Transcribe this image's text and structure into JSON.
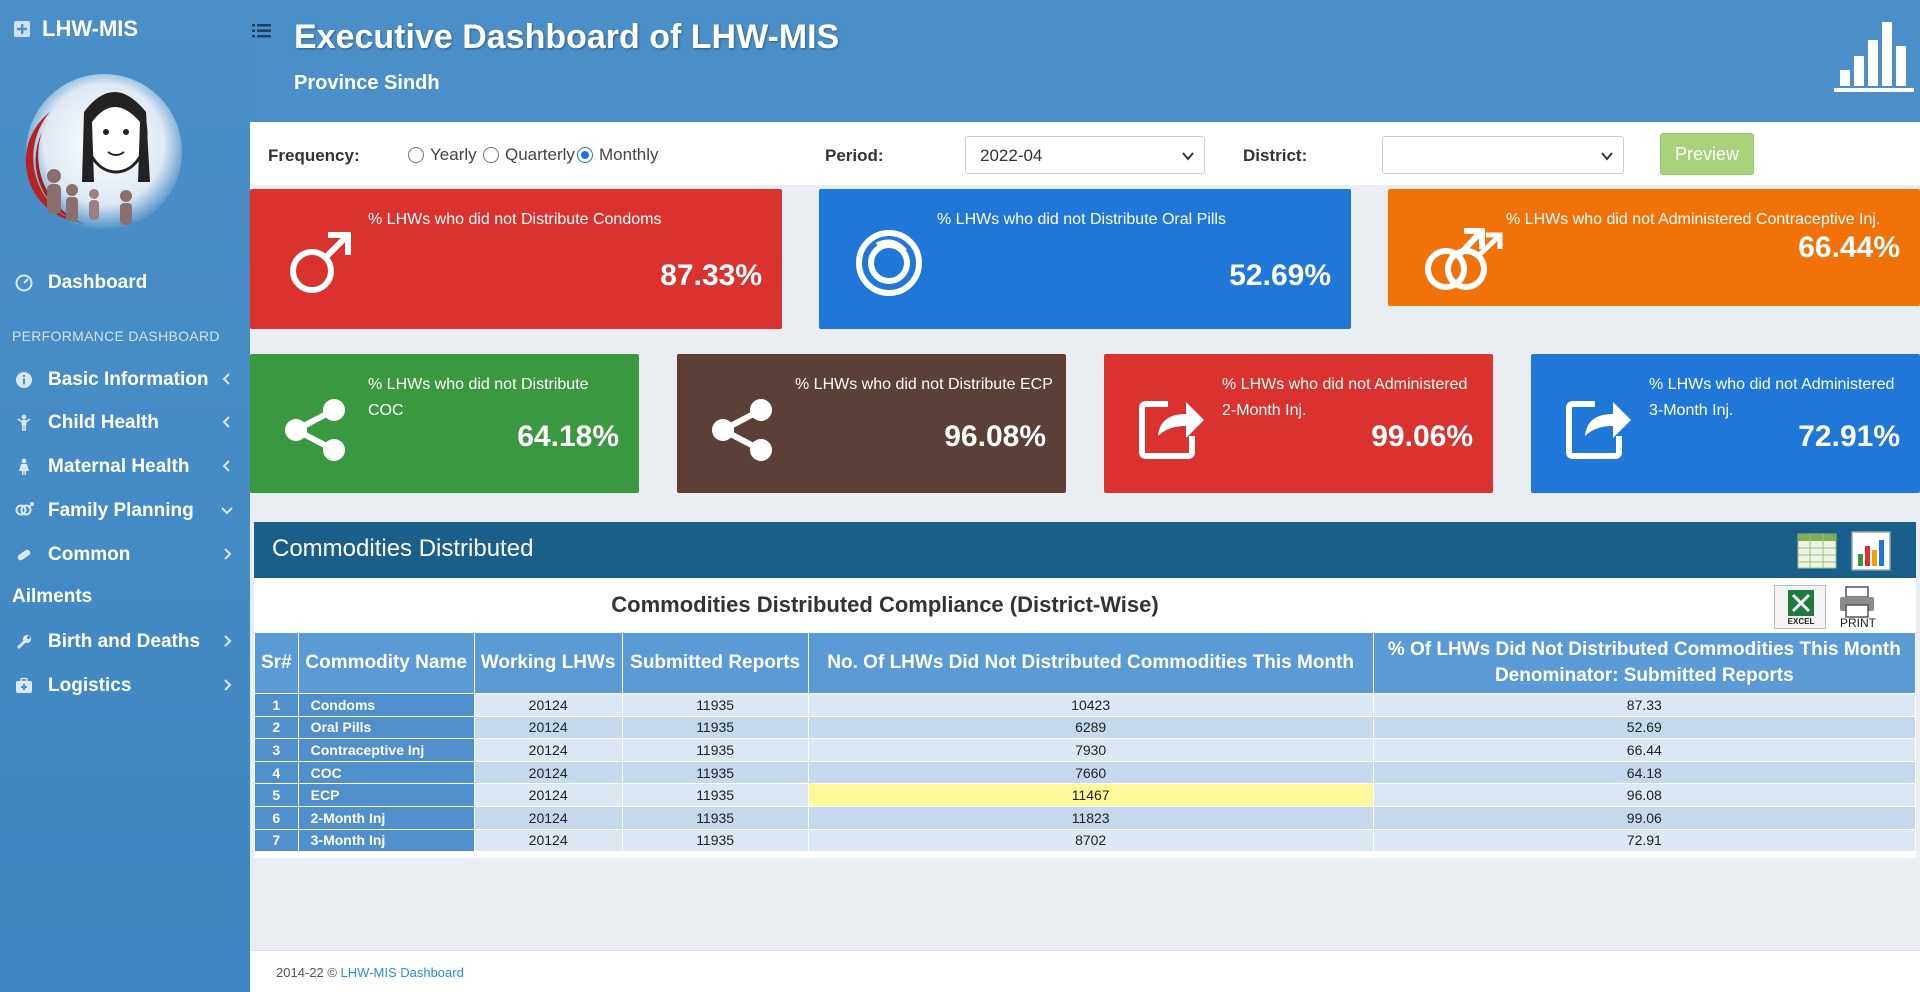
{
  "app": {
    "brand": "LHW-MIS"
  },
  "sidebar": {
    "dashboard": "Dashboard",
    "section_header": "PERFORMANCE DASHBOARD",
    "items": [
      {
        "label": "Basic Information"
      },
      {
        "label": "Child Health"
      },
      {
        "label": "Maternal Health"
      },
      {
        "label": "Family Planning"
      },
      {
        "label": "Common"
      }
    ],
    "ailments": "Ailments",
    "items2": [
      {
        "label": "Birth and Deaths"
      },
      {
        "label": "Logistics"
      }
    ]
  },
  "header": {
    "title": "Executive Dashboard of LHW-MIS",
    "subtitle": "Province Sindh"
  },
  "filters": {
    "frequency_label": "Frequency:",
    "options": [
      "Yearly",
      "Quarterly",
      "Monthly"
    ],
    "selected": "Monthly",
    "period_label": "Period:",
    "period_value": "2022-04",
    "district_label": "District:",
    "district_value": "",
    "preview": "Preview"
  },
  "cards": [
    {
      "text": "% LHWs who did not Distribute Condoms",
      "value": "87.33%",
      "color": "#d9322f"
    },
    {
      "text": "% LHWs who did not Distribute Oral Pills",
      "value": "52.69%",
      "color": "#1f78d8"
    },
    {
      "text": "% LHWs who did not Administered Contraceptive Inj.",
      "value": "66.44%",
      "color": "#f07209"
    },
    {
      "text": "% LHWs who did not Distribute COC",
      "value": "64.18%",
      "color": "#3a9840"
    },
    {
      "text": "% LHWs who did not Distribute ECP",
      "value": "96.08%",
      "color": "#5c4037"
    },
    {
      "text": "% LHWs who did not Administered 2-Month Inj.",
      "value": "99.06%",
      "color": "#d9322f"
    },
    {
      "text": "% LHWs who did not Administered 3-Month Inj.",
      "value": "72.91%",
      "color": "#1f78d8"
    }
  ],
  "panel": {
    "title": "Commodities Distributed",
    "table_title": "Commodities Distributed Compliance (District-Wise)",
    "excel": "EXCEL",
    "print": "PRINT",
    "columns": [
      "Sr#",
      "Commodity Name",
      "Working LHWs",
      "Submitted Reports",
      "No. Of LHWs Did Not Distributed Commodities This Month",
      "% Of LHWs Did Not Distributed Commodities This Month Denominator: Submitted Reports"
    ],
    "rows": [
      [
        "1",
        "Condoms",
        "20124",
        "11935",
        "10423",
        "87.33"
      ],
      [
        "2",
        "Oral Pills",
        "20124",
        "11935",
        "6289",
        "52.69"
      ],
      [
        "3",
        "Contraceptive Inj",
        "20124",
        "11935",
        "7930",
        "66.44"
      ],
      [
        "4",
        "COC",
        "20124",
        "11935",
        "7660",
        "64.18"
      ],
      [
        "5",
        "ECP",
        "20124",
        "11935",
        "11467",
        "96.08"
      ],
      [
        "6",
        "2-Month Inj",
        "20124",
        "11935",
        "11823",
        "99.06"
      ],
      [
        "7",
        "3-Month Inj",
        "20124",
        "11935",
        "8702",
        "72.91"
      ]
    ]
  },
  "footer": {
    "text": "2014-22 © ",
    "link": "LHW-MIS Dashboard"
  }
}
